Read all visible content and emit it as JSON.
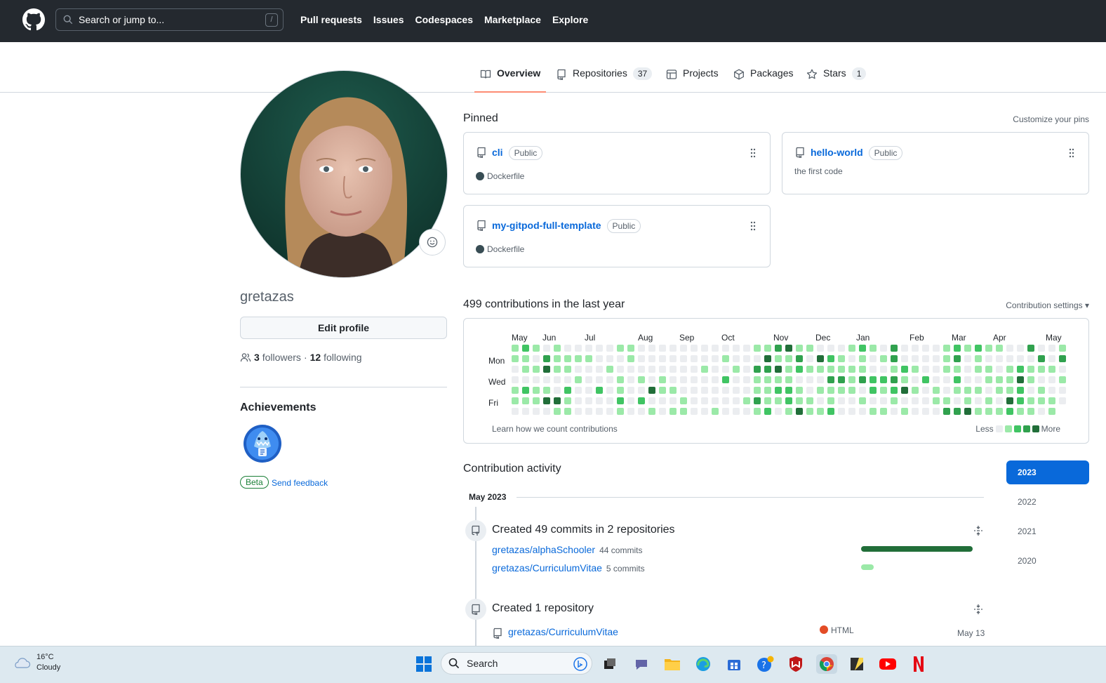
{
  "header": {
    "search_placeholder": "Search or jump to...",
    "search_shortcut": "/",
    "nav": [
      "Pull requests",
      "Issues",
      "Codespaces",
      "Marketplace",
      "Explore"
    ]
  },
  "tabs": [
    {
      "label": "Overview",
      "count": null,
      "active": true
    },
    {
      "label": "Repositories",
      "count": "37"
    },
    {
      "label": "Projects",
      "count": null
    },
    {
      "label": "Packages",
      "count": null
    },
    {
      "label": "Stars",
      "count": "1"
    }
  ],
  "profile": {
    "username": "gretazas",
    "edit_label": "Edit profile",
    "followers_count": "3",
    "followers_label": "followers",
    "separator": "·",
    "following_count": "12",
    "following_label": "following",
    "achievements_title": "Achievements",
    "beta_label": "Beta",
    "feedback_label": "Send feedback"
  },
  "pinned": {
    "title": "Pinned",
    "customize": "Customize your pins",
    "items": [
      {
        "name": "cli",
        "visibility": "Public",
        "language": "Dockerfile",
        "description": ""
      },
      {
        "name": "hello-world",
        "visibility": "Public",
        "language": "",
        "description": "the first code"
      },
      {
        "name": "my-gitpod-full-template",
        "visibility": "Public",
        "language": "Dockerfile",
        "description": ""
      }
    ]
  },
  "contributions": {
    "title": "499 contributions in the last year",
    "settings": "Contribution settings ▾",
    "months": [
      "May",
      "Jun",
      "Jul",
      "Aug",
      "Sep",
      "Oct",
      "Nov",
      "Dec",
      "Jan",
      "Feb",
      "Mar",
      "Apr",
      "May"
    ],
    "days": [
      "Mon",
      "Wed",
      "Fri"
    ],
    "learn": "Learn how we count contributions",
    "less": "Less",
    "more": "More",
    "colors": [
      "#ebedf0",
      "#9be9a8",
      "#40c463",
      "#30a14e",
      "#216e39"
    ]
  },
  "activity": {
    "title": "Contribution activity",
    "years": [
      "2023",
      "2022",
      "2021",
      "2020"
    ],
    "month": "May 2023",
    "commits_title": "Created 49 commits in 2 repositories",
    "commit_repos": [
      {
        "repo": "gretazas/alphaSchooler",
        "commits": "44 commits",
        "fraction": 1.0
      },
      {
        "repo": "gretazas/CurriculumVitae",
        "commits": "5 commits",
        "fraction": 0.11
      }
    ],
    "repo_title": "Created 1 repository",
    "created_repo": {
      "repo": "gretazas/CurriculumVitae",
      "language": "HTML",
      "lang_color": "#e34c26",
      "date": "May 13"
    }
  },
  "taskbar": {
    "temp": "16°C",
    "condition": "Cloudy",
    "search": "Search"
  }
}
